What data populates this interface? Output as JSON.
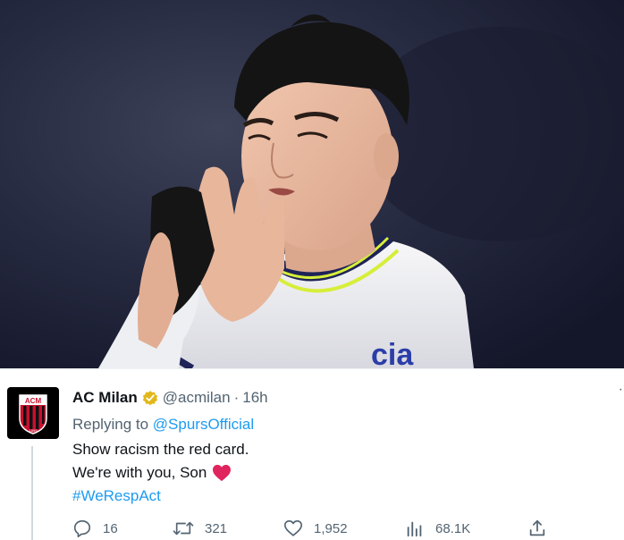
{
  "tweet": {
    "display_name": "AC Milan",
    "handle": "@acmilan",
    "separator": "·",
    "time": "16h",
    "more": "·",
    "replying_prefix": "Replying to",
    "replying_to": "@SpursOfficial",
    "lines": [
      "Show racism the red card.",
      "We're with you, Son"
    ],
    "hashtag": "#WeRespAct",
    "avatar_badge_text": "ACM",
    "avatar_badge_year": "1899"
  },
  "actions": {
    "replies": "16",
    "retweets": "321",
    "likes": "1,952",
    "views": "68.1K"
  },
  "photo": {
    "sponsor_text": "cia"
  },
  "colors": {
    "link": "#1d9bf0",
    "secondary": "#536471",
    "verified_gold": "#e2b719",
    "heart": "#e0245e",
    "kit_trim": "#d7ee3a",
    "kit_navy": "#1e2457"
  }
}
